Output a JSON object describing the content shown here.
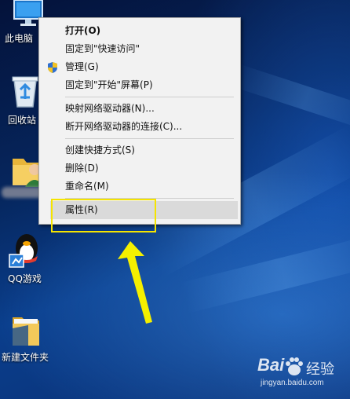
{
  "desktop": {
    "icons": [
      {
        "label": "此电脑",
        "icon": "computer-icon"
      },
      {
        "label": "回收站",
        "icon": "recycle-bin-icon"
      },
      {
        "label": "",
        "icon": "user-folder-icon"
      },
      {
        "label": "QQ游戏",
        "icon": "qq-penguin-icon"
      },
      {
        "label": "新建文件夹",
        "icon": "folder-icon"
      }
    ]
  },
  "context_menu": {
    "items": [
      {
        "label": "打开(O)",
        "bold": true
      },
      {
        "label": "固定到\"快速访问\""
      },
      {
        "label": "管理(G)",
        "icon": "admin-shield-icon"
      },
      {
        "label": "固定到\"开始\"屏幕(P)"
      },
      {
        "label": "映射网络驱动器(N)..."
      },
      {
        "label": "断开网络驱动器的连接(C)..."
      },
      {
        "label": "创建快捷方式(S)"
      },
      {
        "label": "删除(D)"
      },
      {
        "label": "重命名(M)"
      },
      {
        "label": "属性(R)",
        "highlighted": true
      }
    ]
  },
  "annotation": {
    "highlight_color": "#f5e400",
    "arrow_color": "#f5f000"
  },
  "watermark": {
    "brand_left": "Bai",
    "brand_right": "经验",
    "url": "jingyan.baidu.com"
  }
}
